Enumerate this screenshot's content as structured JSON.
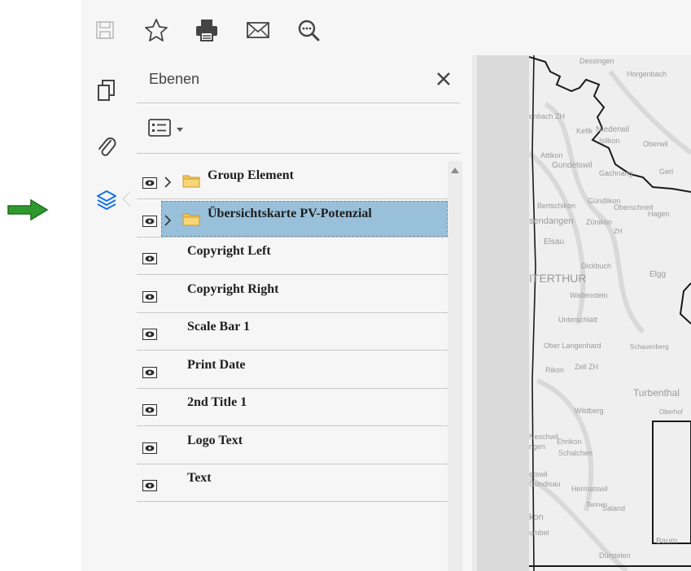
{
  "toolbar": {
    "icons": [
      "save-icon",
      "bookmark-star-icon",
      "print-icon",
      "email-icon",
      "find-icon"
    ]
  },
  "rail": {
    "icons": [
      "pages-icon",
      "attachments-icon",
      "layers-icon"
    ]
  },
  "panel": {
    "title": "Ebenen",
    "layers": [
      {
        "label": "Group Element",
        "expandable": true,
        "folder": true,
        "selected": false
      },
      {
        "label": "Übersichtskarte PV-Potenzial",
        "expandable": true,
        "folder": true,
        "selected": true
      },
      {
        "label": "Copyright Left",
        "expandable": false,
        "folder": false,
        "selected": false
      },
      {
        "label": "Copyright Right",
        "expandable": false,
        "folder": false,
        "selected": false
      },
      {
        "label": "Scale Bar 1",
        "expandable": false,
        "folder": false,
        "selected": false
      },
      {
        "label": "Print Date",
        "expandable": false,
        "folder": false,
        "selected": false
      },
      {
        "label": "2nd Title 1",
        "expandable": false,
        "folder": false,
        "selected": false
      },
      {
        "label": "Logo Text",
        "expandable": false,
        "folder": false,
        "selected": false
      },
      {
        "label": "Text",
        "expandable": false,
        "folder": false,
        "selected": false
      }
    ]
  },
  "map": {
    "labels": [
      "Dessingen",
      "Horgenbach",
      "enbach ZH",
      "Kefik",
      "Niederwil",
      "Islikon",
      "Oberwil",
      "Attikon",
      "Gundetswil",
      "Gachnang",
      "Gerl",
      "Gündlikon",
      "Bertschikon",
      "Oberschneit",
      "Hagen",
      "sendangen",
      "Zünikon",
      "ZH",
      "Elsau",
      "Dickbuch",
      "ITERTHUR",
      "Elgg",
      "Waltenstein",
      "Unterschlatt",
      "Ober Langenhard",
      "Schauenberg",
      "Rikon",
      "Zell ZH",
      "Turbenthal",
      "Wildberg",
      "Oberhof",
      "Neschwil",
      "Ehrikon",
      "ngen",
      "Schalchen",
      "etswil",
      "Gündisau",
      "Hermatswil",
      "kon",
      "Saland",
      "Tannen",
      "umbel",
      "Dürstelen",
      "Baum"
    ]
  },
  "colors": {
    "accent": "#1473e6",
    "selection": "#99c0da",
    "folder": "#f2c85a",
    "pointer_arrow": "#2e9a2e"
  }
}
